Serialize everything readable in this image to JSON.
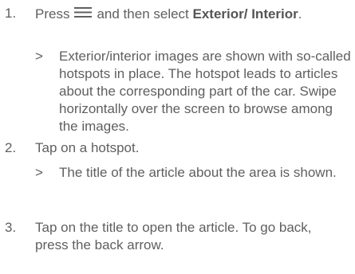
{
  "steps": [
    {
      "number": "1.",
      "pre": "Press",
      "icon": "menu-icon",
      "mid": "and then select",
      "bold": "Exterior/ Interior",
      "post": ".",
      "result": "Exterior/interior images are shown with so-called hotspots in place. The hotspot leads to articles about the corresponding part of the car. Swipe horizontally over the screen to browse among the images."
    },
    {
      "number": "2.",
      "text": "Tap on a hotspot.",
      "result": "The title of the article about the area is shown."
    },
    {
      "number": "3.",
      "text": "Tap on the title to open the article. To go back, press the back arrow."
    }
  ],
  "result_marker": ">"
}
